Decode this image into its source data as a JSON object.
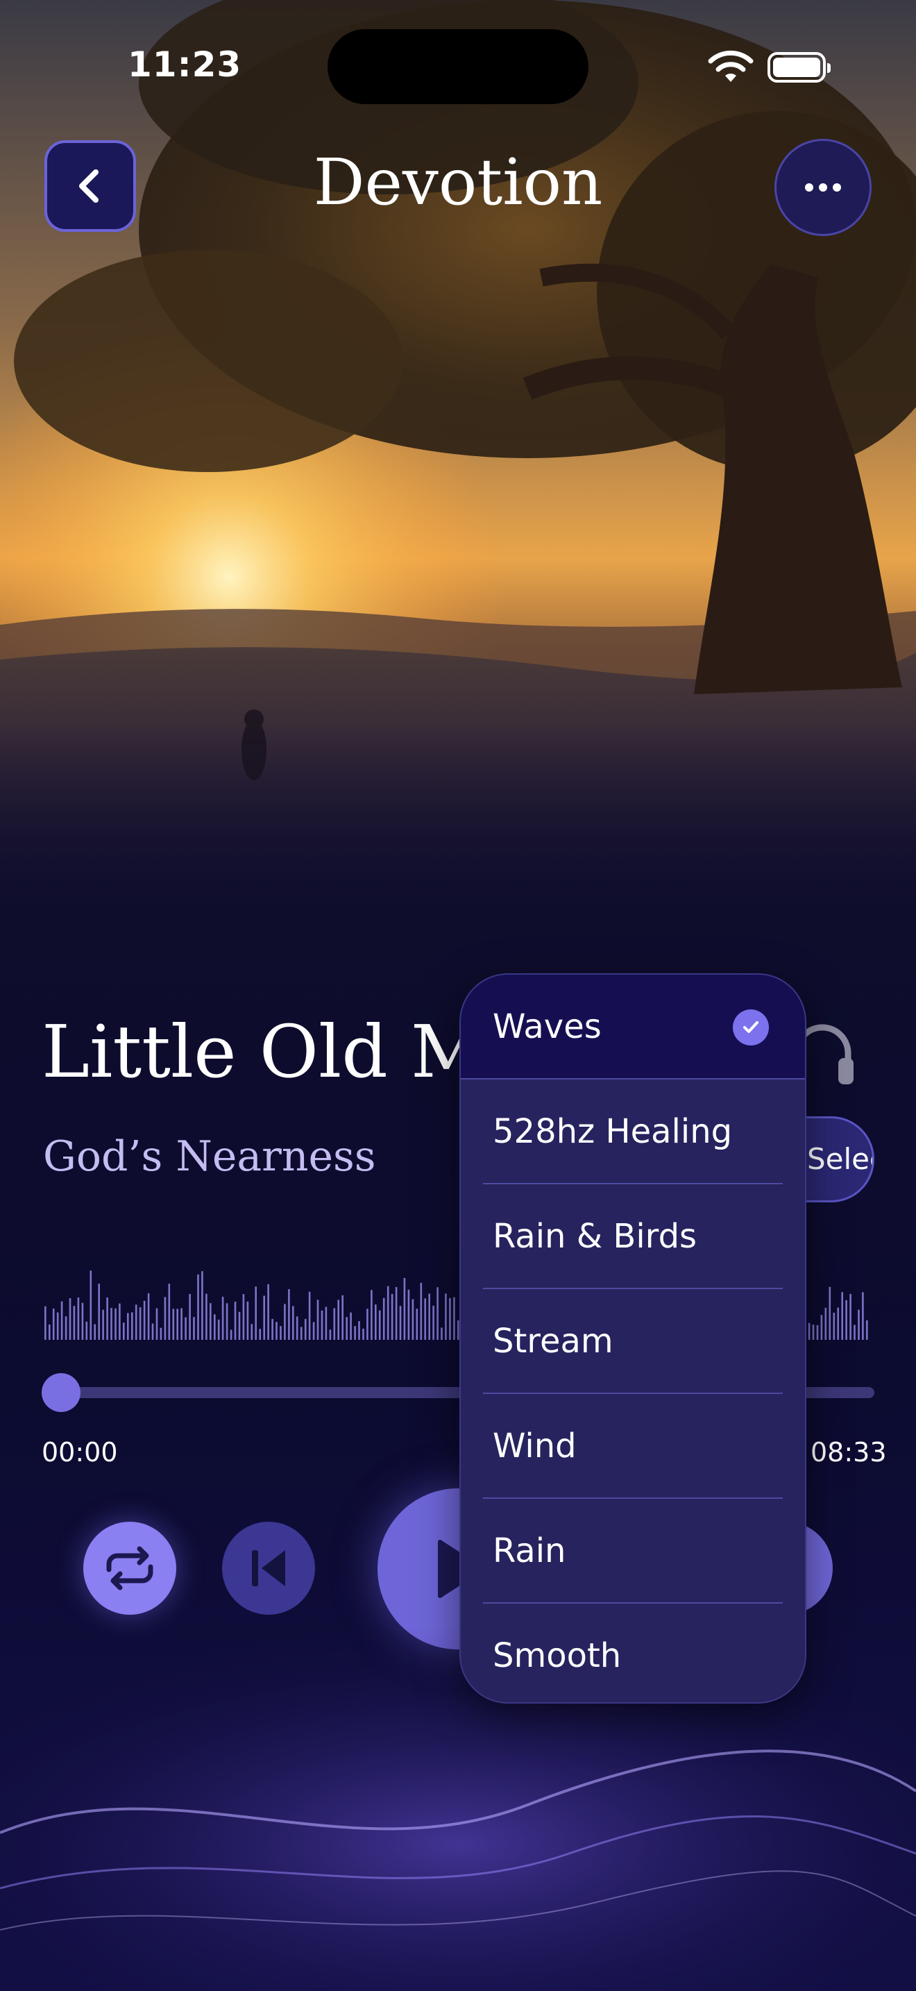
{
  "status_bar": {
    "time": "11:23"
  },
  "header": {
    "title": "Devotion"
  },
  "track": {
    "title": "Little Old Me",
    "subtitle": "God’s Nearness",
    "select_label": "Select"
  },
  "player": {
    "elapsed": "00:00",
    "duration": "08:33",
    "progress_fraction": 0.0
  },
  "sound_menu": {
    "selected": "Waves",
    "options": [
      "Waves",
      "528hz Healing",
      "Rain & Birds",
      "Stream",
      "Wind",
      "Rain",
      "Smooth"
    ]
  },
  "colors": {
    "accent": "#7c72ee",
    "background": "#0e0d2c",
    "menu": "#26235e"
  }
}
